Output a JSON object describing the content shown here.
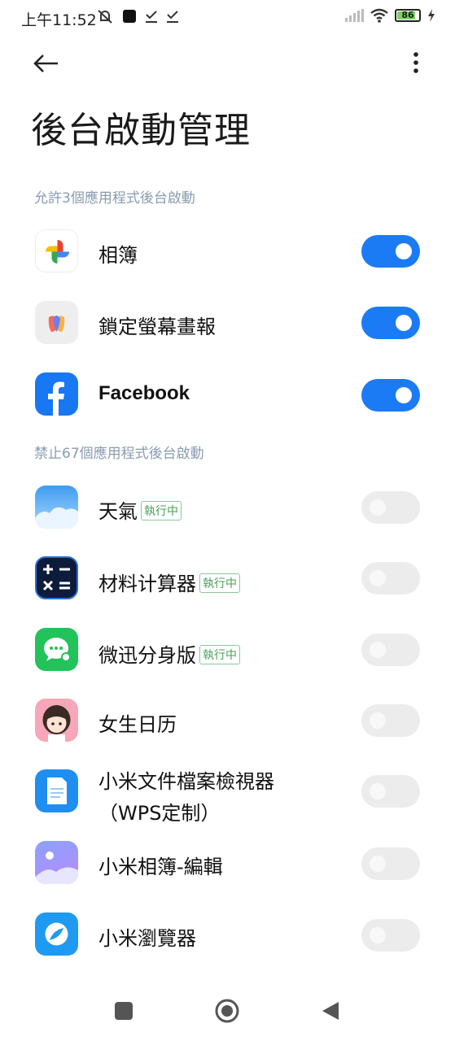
{
  "status_bar": {
    "time": "上午11:52",
    "battery": "86"
  },
  "header": {
    "title": "後台啟動管理"
  },
  "allowed": {
    "label": "允許3個應用程式後台啟動",
    "apps": [
      {
        "name": "相簿",
        "enabled": true
      },
      {
        "name": "鎖定螢幕畫報",
        "enabled": true
      },
      {
        "name": "Facebook",
        "enabled": true
      }
    ]
  },
  "blocked": {
    "label": "禁止67個應用程式後台啟動",
    "apps": [
      {
        "name": "天氣",
        "badge": "執行中",
        "enabled": false
      },
      {
        "name": "材料计算器",
        "badge": "執行中",
        "enabled": false
      },
      {
        "name": "微迅分身版",
        "badge": "執行中",
        "enabled": false
      },
      {
        "name": "女生日历",
        "enabled": false
      },
      {
        "name": "小米文件檔案檢視器",
        "name_line2": "（WPS定制）",
        "enabled": false
      },
      {
        "name": "小米相簿-編輯",
        "enabled": false
      },
      {
        "name": "小米瀏覽器",
        "enabled": false
      }
    ]
  },
  "colors": {
    "accent": "#1a7bf5",
    "section_text": "#8a9bb0",
    "badge": "#4a9f5a"
  }
}
